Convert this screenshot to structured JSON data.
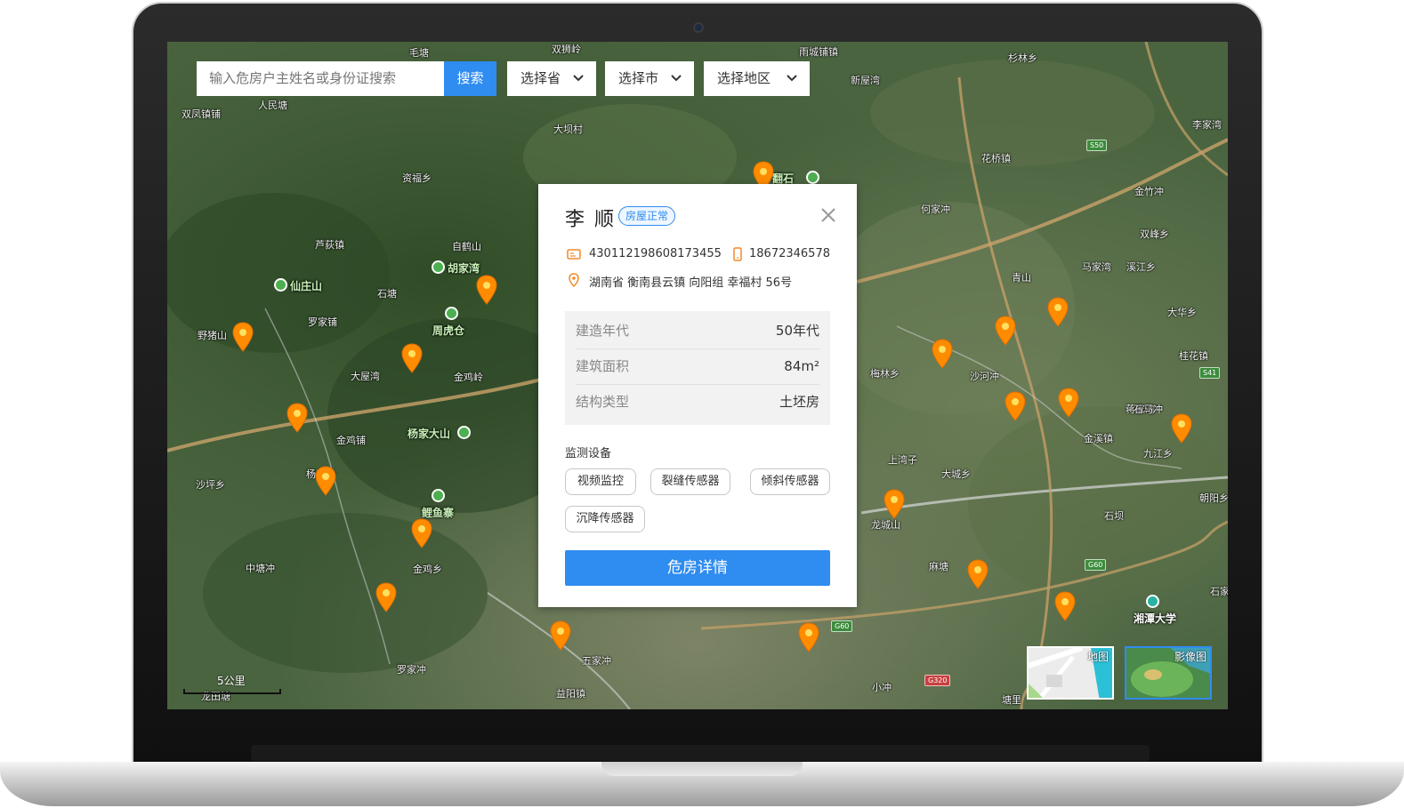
{
  "search": {
    "placeholder": "输入危房户主姓名或身份证搜索",
    "button_label": "搜索"
  },
  "filters": {
    "province_label": "选择省",
    "city_label": "选择市",
    "district_label": "选择地区"
  },
  "popup": {
    "name": "李 顺",
    "status": "房屋正常",
    "id_number": "430112198608173455",
    "phone": "18672346578",
    "address": "湖南省 衡南县云镇 向阳组 幸福村 56号",
    "attributes": [
      {
        "key": "建造年代",
        "value": "50年代"
      },
      {
        "key": "建筑面积",
        "value": "84m²"
      },
      {
        "key": "结构类型",
        "value": "土坯房"
      }
    ],
    "devices_title": "监测设备",
    "devices": [
      "视频监控",
      "裂缝传感器",
      "倾斜传感器",
      "沉降传感器"
    ],
    "detail_button": "危房详情"
  },
  "map": {
    "scale_label": "5公里",
    "layer_map_label": "地图",
    "layer_satellite_label": "影像图",
    "place_labels": [
      "毛塘",
      "双狮岭",
      "雨城铺镇",
      "双凤镇铺",
      "人民塘",
      "大坝村",
      "新屋湾",
      "杉林乡",
      "资福乡",
      "芦荻镇",
      "自鹤山",
      "石塘",
      "罗家铺",
      "野猪山",
      "大屋湾",
      "金鸡岭",
      "沙坪乡",
      "中塘冲",
      "罗家冲",
      "五家冲",
      "益阳镇",
      "金鸡乡",
      "金鸡铺",
      "梅林乡",
      "沙河冲",
      "金竹冲",
      "花桥镇",
      "双峰乡",
      "溪江乡",
      "马家湾",
      "青山",
      "大华乡",
      "九江乡",
      "金溪镇",
      "何家冲",
      "龙城山",
      "蒋家湾",
      "石坝",
      "上湾子",
      "大城乡",
      "麻塘",
      "石马冲",
      "李家湾",
      "桂花镇",
      "朝阳乡",
      "石家冲",
      "塘里",
      "小冲",
      "龙田塘",
      "杨家冲"
    ],
    "poi_labels": [
      "翻石",
      "胡家湾",
      "周虎仓",
      "杨家大山",
      "鲤鱼寨",
      "仙庄山",
      "湘潭大学"
    ],
    "road_badges": [
      "S50",
      "S41",
      "G60",
      "G60",
      "G320"
    ]
  },
  "colors": {
    "accent": "#2f8cf0",
    "pin": "#ff8c00",
    "status_tag": "#2f8cf0"
  }
}
